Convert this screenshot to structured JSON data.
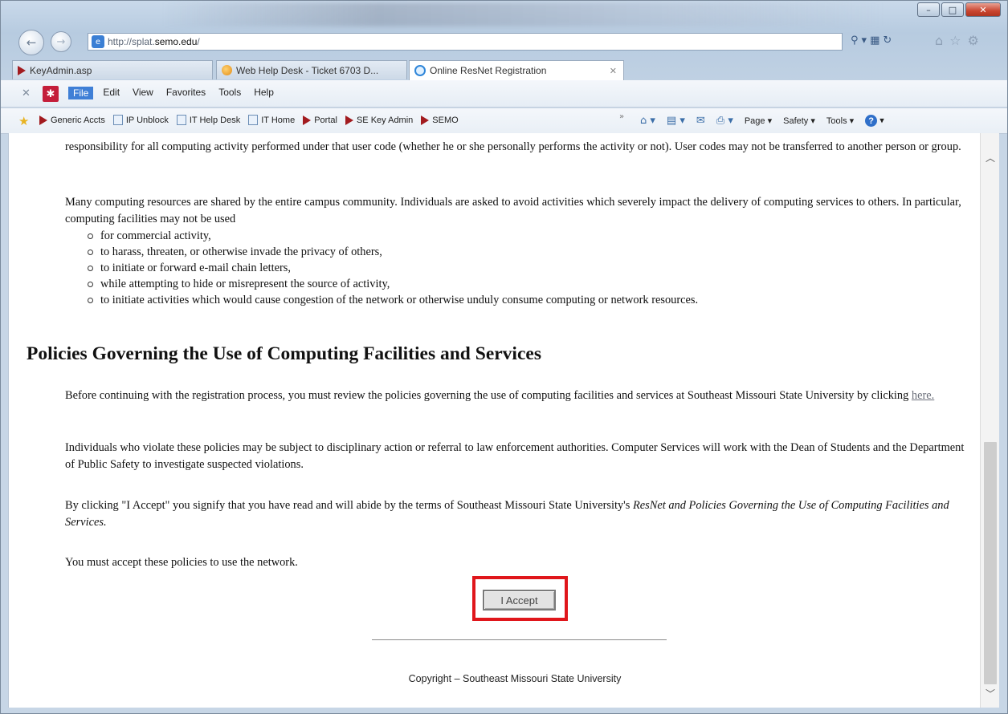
{
  "browser": {
    "url_prefix": "http://splat.",
    "url_domain": "semo.edu",
    "url_suffix": "/",
    "search_icon": "⚲",
    "window_controls": [
      "–",
      "□",
      "✕"
    ],
    "tabs": [
      {
        "label": "KeyAdmin.asp",
        "icon": "semo-icon"
      },
      {
        "label": "Web Help Desk - Ticket 6703 D...",
        "icon": "whd-icon"
      },
      {
        "label": "Online ResNet Registration",
        "icon": "ie-icon",
        "close": "✕"
      }
    ],
    "menu": [
      "File",
      "Edit",
      "View",
      "Favorites",
      "Tools",
      "Help"
    ],
    "favorites": [
      {
        "label": "Generic Accts",
        "icon": "semo-icon"
      },
      {
        "label": "IP Unblock",
        "icon": "page-icon"
      },
      {
        "label": "IT Help Desk",
        "icon": "page-icon"
      },
      {
        "label": "IT Home",
        "icon": "page-icon"
      },
      {
        "label": "Portal",
        "icon": "semo-icon"
      },
      {
        "label": "SE Key Admin",
        "icon": "semo-icon"
      },
      {
        "label": "SEMO",
        "icon": "semo-icon"
      }
    ],
    "command_bar": {
      "page": "Page ▾",
      "safety": "Safety ▾",
      "tools": "Tools ▾",
      "help": "?"
    }
  },
  "page": {
    "intro_paragraph": "responsibility for all computing activity performed under that user code (whether he or she personally performs the activity or not). User codes may not be transferred to another person or group.",
    "shared_paragraph": "Many computing resources are shared by the entire campus community. Individuals are asked to avoid activities which severely impact the delivery of computing services to others. In particular, computing facilities may not be used",
    "bullets": [
      "for commercial activity,",
      "to harass, threaten, or otherwise invade the privacy of others,",
      "to initiate or forward e-mail chain letters,",
      "while attempting to hide or misrepresent the source of activity,",
      "to initiate activities which would cause congestion of the network or otherwise unduly consume computing or network resources."
    ],
    "heading": "Policies Governing the Use of Computing Facilities and Services",
    "review_text": "Before continuing with the registration process, you must review the policies governing the use of computing facilities and services at Southeast Missouri State University by clicking",
    "review_link": "here.",
    "violate_paragraph": "Individuals who violate these policies may be subject to disciplinary action or referral to law enforcement authorities. Computer Services will work with the Dean of Students and the Department of Public Safety to investigate suspected violations.",
    "accept_text_plain": "By clicking \"I Accept\" you signify that you have read and will abide by the terms of Southeast Missouri State University's",
    "accept_text_italic": "ResNet and Policies Governing the Use of Computing Facilities and Services.",
    "must_accept": "You must accept these policies to use the network.",
    "accept_button": "I Accept",
    "copyright": "Copyright – Southeast Missouri State University"
  },
  "colors": {
    "highlight_box": "#e0161b",
    "link": "#6b6f7a",
    "semo_red": "#a21b1f"
  }
}
